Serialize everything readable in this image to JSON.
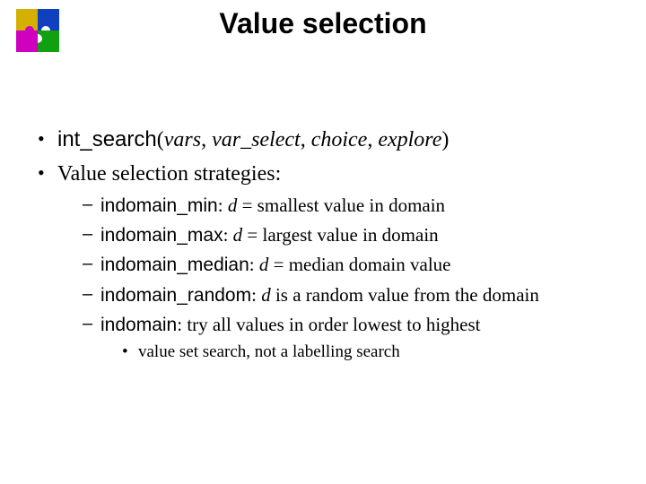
{
  "title": "Value selection",
  "bullets": {
    "b1": {
      "code": "int_search",
      "open": "(",
      "arg1": "vars",
      "sep1": ", ",
      "arg2": "var_select",
      "sep2": ", ",
      "arg3": "choice",
      "sep3": ", ",
      "arg4": "explore",
      "close": ")"
    },
    "b2": {
      "text": "Value selection strategies:",
      "items": [
        {
          "code": "indomain_min",
          "sep": ": ",
          "dvar": "d",
          "rest": " = smallest value in domain"
        },
        {
          "code": "indomain_max",
          "sep": ": ",
          "dvar": "d",
          "rest": " = largest value in domain"
        },
        {
          "code": "indomain_median",
          "sep": ": ",
          "dvar": "d",
          "rest": " = median domain value"
        },
        {
          "code": "indomain_random",
          "sep": ": ",
          "dvar": "d",
          "rest": " is a random value from the domain"
        },
        {
          "code": "indomain",
          "sep": ": ",
          "dvar": "",
          "rest": "try all values in order lowest to highest",
          "sub": [
            "value set search, not a labelling search"
          ]
        }
      ]
    }
  },
  "logo": {
    "name": "puzzle-logo"
  }
}
